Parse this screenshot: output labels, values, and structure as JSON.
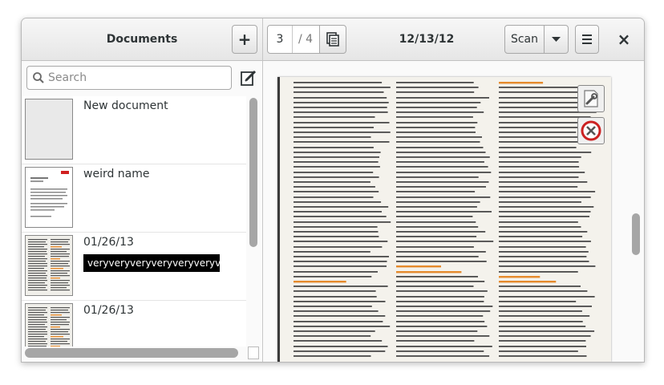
{
  "header": {
    "title": "Documents",
    "add_label": "+",
    "page_current": "3",
    "page_total": "/ 4",
    "date": "12/13/12",
    "scan_label": "Scan",
    "close_label": "×"
  },
  "sidebar": {
    "search_placeholder": "Search",
    "documents": [
      {
        "name": "New document",
        "thumbnail": "blank"
      },
      {
        "name": "weird name",
        "thumbnail": "letter"
      },
      {
        "name": "01/26/13",
        "thumbnail": "scan",
        "rename_value": "veryveryveryveryveryveryveryveryvery"
      },
      {
        "name": "01/26/13",
        "thumbnail": "scan"
      }
    ]
  },
  "colors": {
    "accent_orange": "#e58a2c",
    "close_red": "#cc2222",
    "logo_red": "#d02020"
  },
  "icons": {
    "add": "plus-icon",
    "pages": "pages-icon",
    "dropdown": "chevron-down-icon",
    "menu": "hamburger-menu-icon",
    "close": "close-icon",
    "search": "search-icon",
    "rename": "edit-icon",
    "settings": "wrench-icon",
    "delete": "delete-icon"
  }
}
